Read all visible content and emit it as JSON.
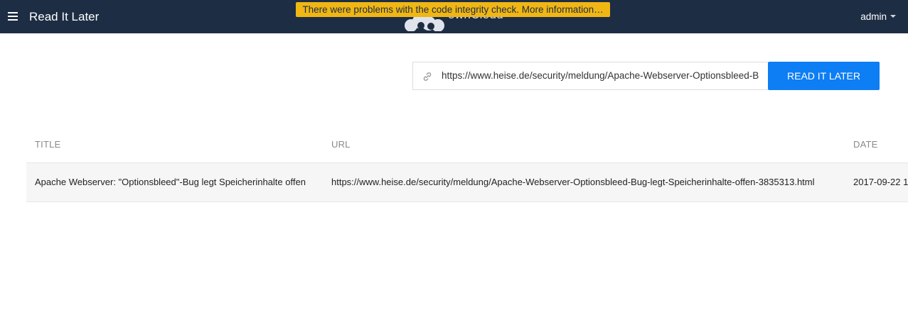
{
  "header": {
    "app_title": "Read It Later",
    "logo_text": "ownCloud",
    "integrity_warning": "There were problems with the code integrity check. More information…",
    "user": "admin"
  },
  "form": {
    "url_value": "https://www.heise.de/security/meldung/Apache-Webserver-Optionsbleed-B",
    "submit_label": "READ IT LATER"
  },
  "table": {
    "columns": [
      "TITLE",
      "URL",
      "DATE"
    ],
    "rows": [
      {
        "title": "Apache Webserver: \"Optionsbleed\"-Bug legt Speicherinhalte offen",
        "url": "https://www.heise.de/security/meldung/Apache-Webserver-Optionsbleed-Bug-legt-Speicherinhalte-offen-3835313.html",
        "date": "2017-09-22 1"
      }
    ]
  },
  "colors": {
    "header_bg": "#1d2d44",
    "warning_bg": "#f0b614",
    "button_bg": "#0d7ef3"
  },
  "icons": [
    "menu-icon",
    "owncloud-logo",
    "link-icon",
    "caret-down-icon"
  ]
}
